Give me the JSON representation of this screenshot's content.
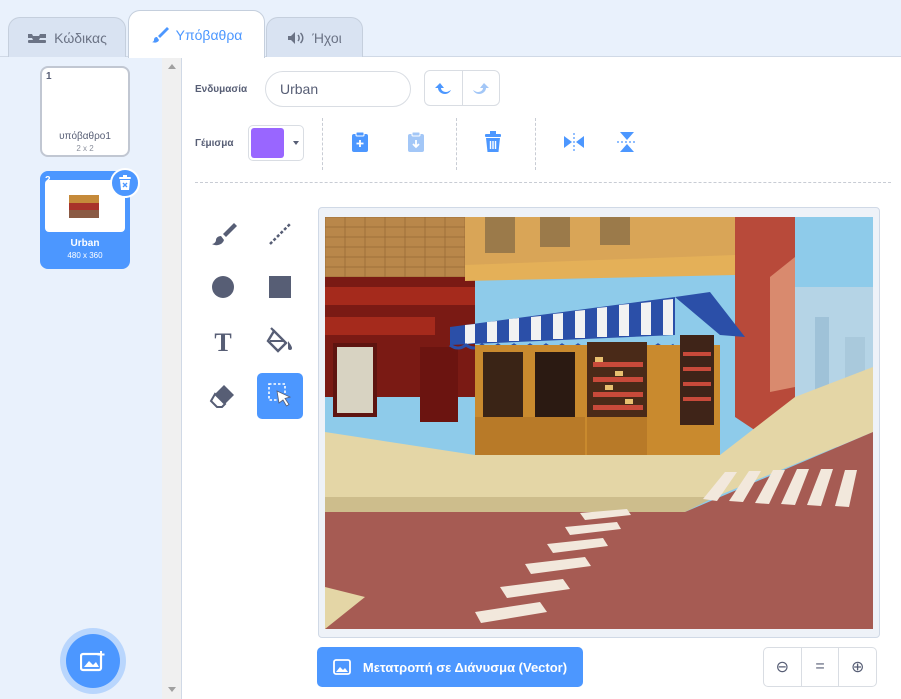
{
  "tabs": [
    {
      "label": "Κώδικας",
      "icon": "code-blocks-icon",
      "active": false
    },
    {
      "label": "Υπόβαθρα",
      "icon": "paintbrush-icon",
      "active": true
    },
    {
      "label": "Ήχοι",
      "icon": "speaker-icon",
      "active": false
    }
  ],
  "backdrops": [
    {
      "number": "1",
      "name": "υπόβαθρο1",
      "size": "2 x 2",
      "selected": false
    },
    {
      "number": "2",
      "name": "Urban",
      "size": "480 x 360",
      "selected": true
    }
  ],
  "editor": {
    "costume_label": "Ενδυμασία",
    "costume_name": "Urban",
    "fill_label": "Γέμισμα",
    "fill_color": "#9966ff"
  },
  "toolbar_icons": [
    "undo-icon",
    "redo-icon",
    "paste-icon",
    "copy-icon",
    "delete-icon",
    "flip-horizontal-icon",
    "flip-vertical-icon"
  ],
  "tools": [
    "brush",
    "line",
    "circle",
    "rectangle",
    "text",
    "fill",
    "eraser",
    "select"
  ],
  "active_tool": "select",
  "convert_button": "Μετατροπή σε Διάνυσμα (Vector)",
  "zoom": {
    "out": "⊖",
    "reset": "=",
    "in": "⊕"
  },
  "accent_color": "#4c97ff"
}
